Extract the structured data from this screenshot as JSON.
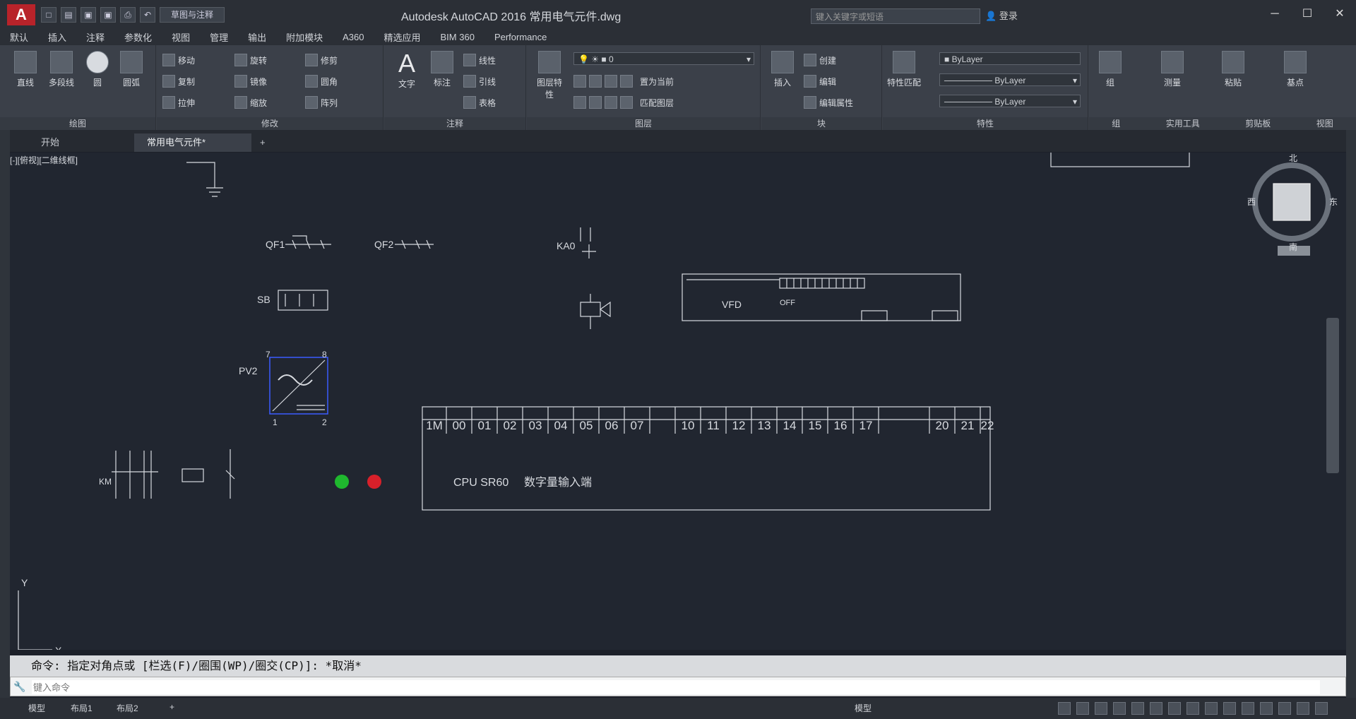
{
  "app": {
    "logo_letter": "A",
    "title": "Autodesk AutoCAD 2016     常用电气元件.dwg",
    "search_placeholder": "键入关键字或短语",
    "workspace": "草图与注释",
    "user": "登录"
  },
  "menu": [
    "默认",
    "插入",
    "注释",
    "参数化",
    "视图",
    "管理",
    "输出",
    "附加模块",
    "A360",
    "精选应用",
    "BIM 360",
    "Performance"
  ],
  "ribbon": {
    "panels": {
      "draw": "绘图",
      "modify": "修改",
      "annotation": "注释",
      "layers": "图层",
      "block": "块",
      "properties": "特性",
      "groups": "组",
      "utilities": "实用工具",
      "clipboard": "剪贴板",
      "view": "视图"
    },
    "draw_tools": {
      "line": "直线",
      "polyline": "多段线",
      "circle": "圆",
      "arc": "圆弧"
    },
    "modify_tools": {
      "move": "移动",
      "rotate": "旋转",
      "trim": "修剪",
      "copy": "复制",
      "mirror": "镜像",
      "fillet": "圆角",
      "stretch": "拉伸",
      "scale": "缩放",
      "array": "阵列"
    },
    "annotation_tools": {
      "text": "文字",
      "dimension": "标注",
      "linear": "线性",
      "leader": "引线",
      "table": "表格"
    },
    "layer_tools": {
      "layer_properties": "图层特性",
      "current_layer": "0",
      "set_current": "置为当前",
      "match_layer": "匹配图层"
    },
    "block_tools": {
      "insert": "插入",
      "create": "创建",
      "edit": "编辑",
      "edit_attrs": "编辑属性"
    },
    "property_tools": {
      "match": "特性匹配",
      "bylayer1": "ByLayer",
      "bylayer2": "ByLayer",
      "bylayer3": "ByLayer"
    },
    "group_tool": "组",
    "measure_tool": "测量",
    "paste_tool": "粘贴",
    "base_tool": "基点"
  },
  "doc_tabs": [
    "开始",
    "常用电气元件*"
  ],
  "viewport_label": "[-][俯视][二维线框]",
  "drawing": {
    "labels": {
      "qf1": "QF1",
      "qf2": "QF2",
      "ka0": "KA0",
      "pv2": "PV2",
      "sb": "SB",
      "km": "KM",
      "vfd_title": "VFD",
      "cpu": "CPU SR60",
      "cpu_desc": "数字量输入端",
      "off": "OFF",
      "pin7": "7",
      "pin8": "8",
      "pin1": "1",
      "pin2": "2"
    },
    "terminals_a": [
      "1M",
      "00",
      "01",
      "02",
      "03",
      "04",
      "05",
      "06",
      "07"
    ],
    "terminals_b": [
      "10",
      "11",
      "12",
      "13",
      "14",
      "15",
      "16",
      "17"
    ],
    "terminals_c": [
      "20",
      "21",
      "22"
    ],
    "lamp_green": "#1fb82e",
    "lamp_red": "#d8202a",
    "line_color": "#d8dbe0",
    "highlight_color": "#3a5bff"
  },
  "viewcube": {
    "top": "北",
    "bottom": "南",
    "left": "西",
    "right": "东",
    "wcs": "WCS"
  },
  "ucs": {
    "x": "X",
    "y": "Y"
  },
  "command": {
    "history": "命令: 指定对角点或 [栏选(F)/圈围(WP)/圈交(CP)]: *取消*",
    "placeholder": "键入命令"
  },
  "status": {
    "model": "模型",
    "layout1": "布局1",
    "layout2": "布局2",
    "model_btn": "模型"
  }
}
